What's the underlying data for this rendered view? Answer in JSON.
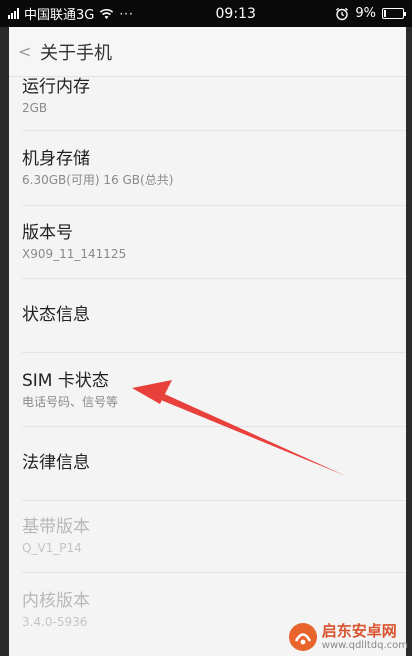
{
  "status_bar": {
    "carrier": "中国联通3G",
    "dots": "···",
    "time": "09:13",
    "battery_text": "9%",
    "battery_level": 0.09
  },
  "header": {
    "title": "关于手机"
  },
  "items": [
    {
      "title": "运行内存",
      "subtitle": "2GB",
      "enabled": true
    },
    {
      "title": "机身存储",
      "subtitle": "6.30GB(可用)   16 GB(总共)",
      "enabled": true
    },
    {
      "title": "版本号",
      "subtitle": "X909_11_141125",
      "enabled": true
    },
    {
      "title": "状态信息",
      "subtitle": "",
      "enabled": true
    },
    {
      "title": "SIM 卡状态",
      "subtitle": "电话号码、信号等",
      "enabled": true
    },
    {
      "title": "法律信息",
      "subtitle": "",
      "enabled": true
    },
    {
      "title": "基带版本",
      "subtitle": "Q_V1_P14",
      "enabled": false
    },
    {
      "title": "内核版本",
      "subtitle": "3.4.0-5936",
      "enabled": false
    }
  ],
  "watermark": {
    "title": "启东安卓网",
    "url": "www.qdlltdq.com"
  },
  "colors": {
    "annotation_arrow": "#e8413c",
    "watermark_accent": "#e8642c"
  }
}
